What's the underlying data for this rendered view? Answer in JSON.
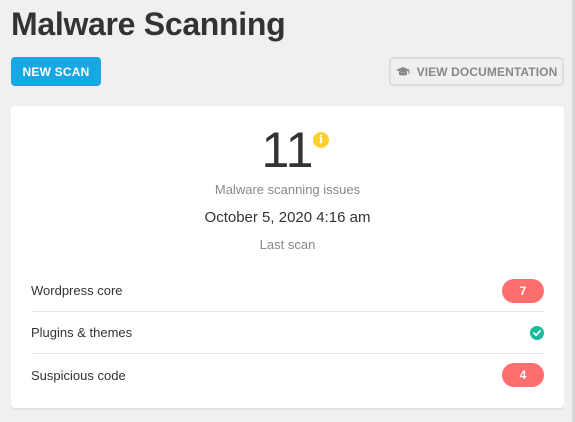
{
  "header": {
    "title": "Malware Scanning",
    "new_scan_label": "NEW SCAN",
    "view_docs_label": "VIEW DOCUMENTATION",
    "docs_icon": "graduation-cap-icon"
  },
  "summary": {
    "issue_count": "11",
    "info_icon": "i",
    "issue_label": "Malware scanning issues",
    "last_scan_date": "October 5, 2020 4:16 am",
    "last_scan_label": "Last scan"
  },
  "rows": [
    {
      "label": "Wordpress core",
      "count": "7",
      "status": "issues"
    },
    {
      "label": "Plugins & themes",
      "count": "",
      "status": "ok"
    },
    {
      "label": "Suspicious code",
      "count": "4",
      "status": "issues"
    }
  ],
  "colors": {
    "primary": "#17a8e3",
    "warning": "#fecf2f",
    "danger": "#ff6d6d",
    "success": "#1abc9c"
  }
}
